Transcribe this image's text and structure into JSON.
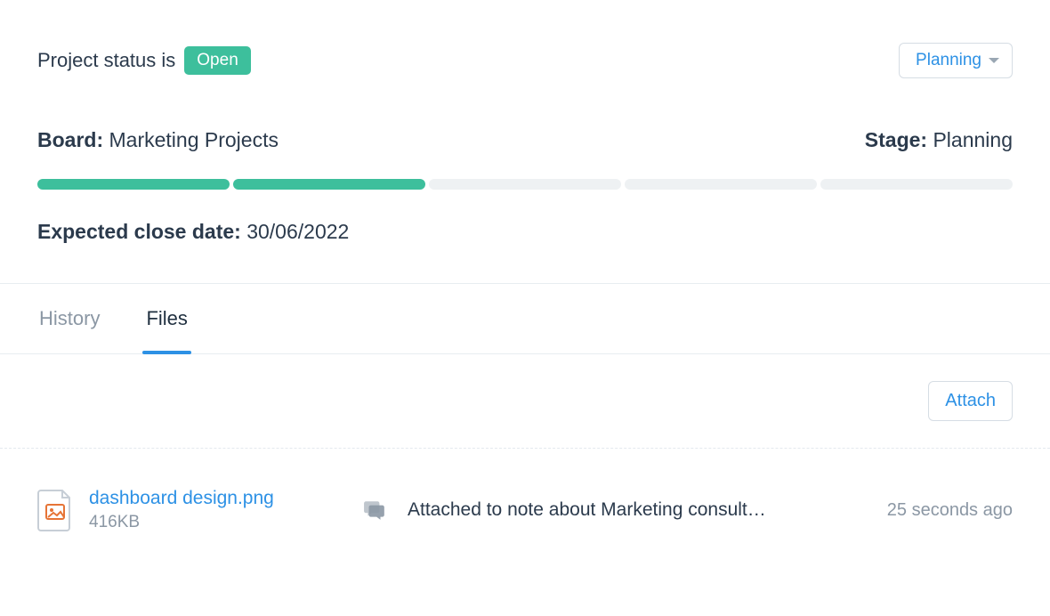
{
  "status": {
    "prefix": "Project status is",
    "value": "Open"
  },
  "stage_select": {
    "value": "Planning"
  },
  "board": {
    "label": "Board:",
    "value": "Marketing Projects"
  },
  "stage": {
    "label": "Stage:",
    "value": "Planning"
  },
  "progress": {
    "segments": 5,
    "filled": 2
  },
  "close_date": {
    "label": "Expected close date:",
    "value": "30/06/2022"
  },
  "tabs": {
    "history": "History",
    "files": "Files",
    "active": "files"
  },
  "attach_button": "Attach",
  "file": {
    "name": "dashboard design.png",
    "size": "416KB",
    "note": "Attached to note about Marketing consult…",
    "time": "25 seconds ago"
  }
}
